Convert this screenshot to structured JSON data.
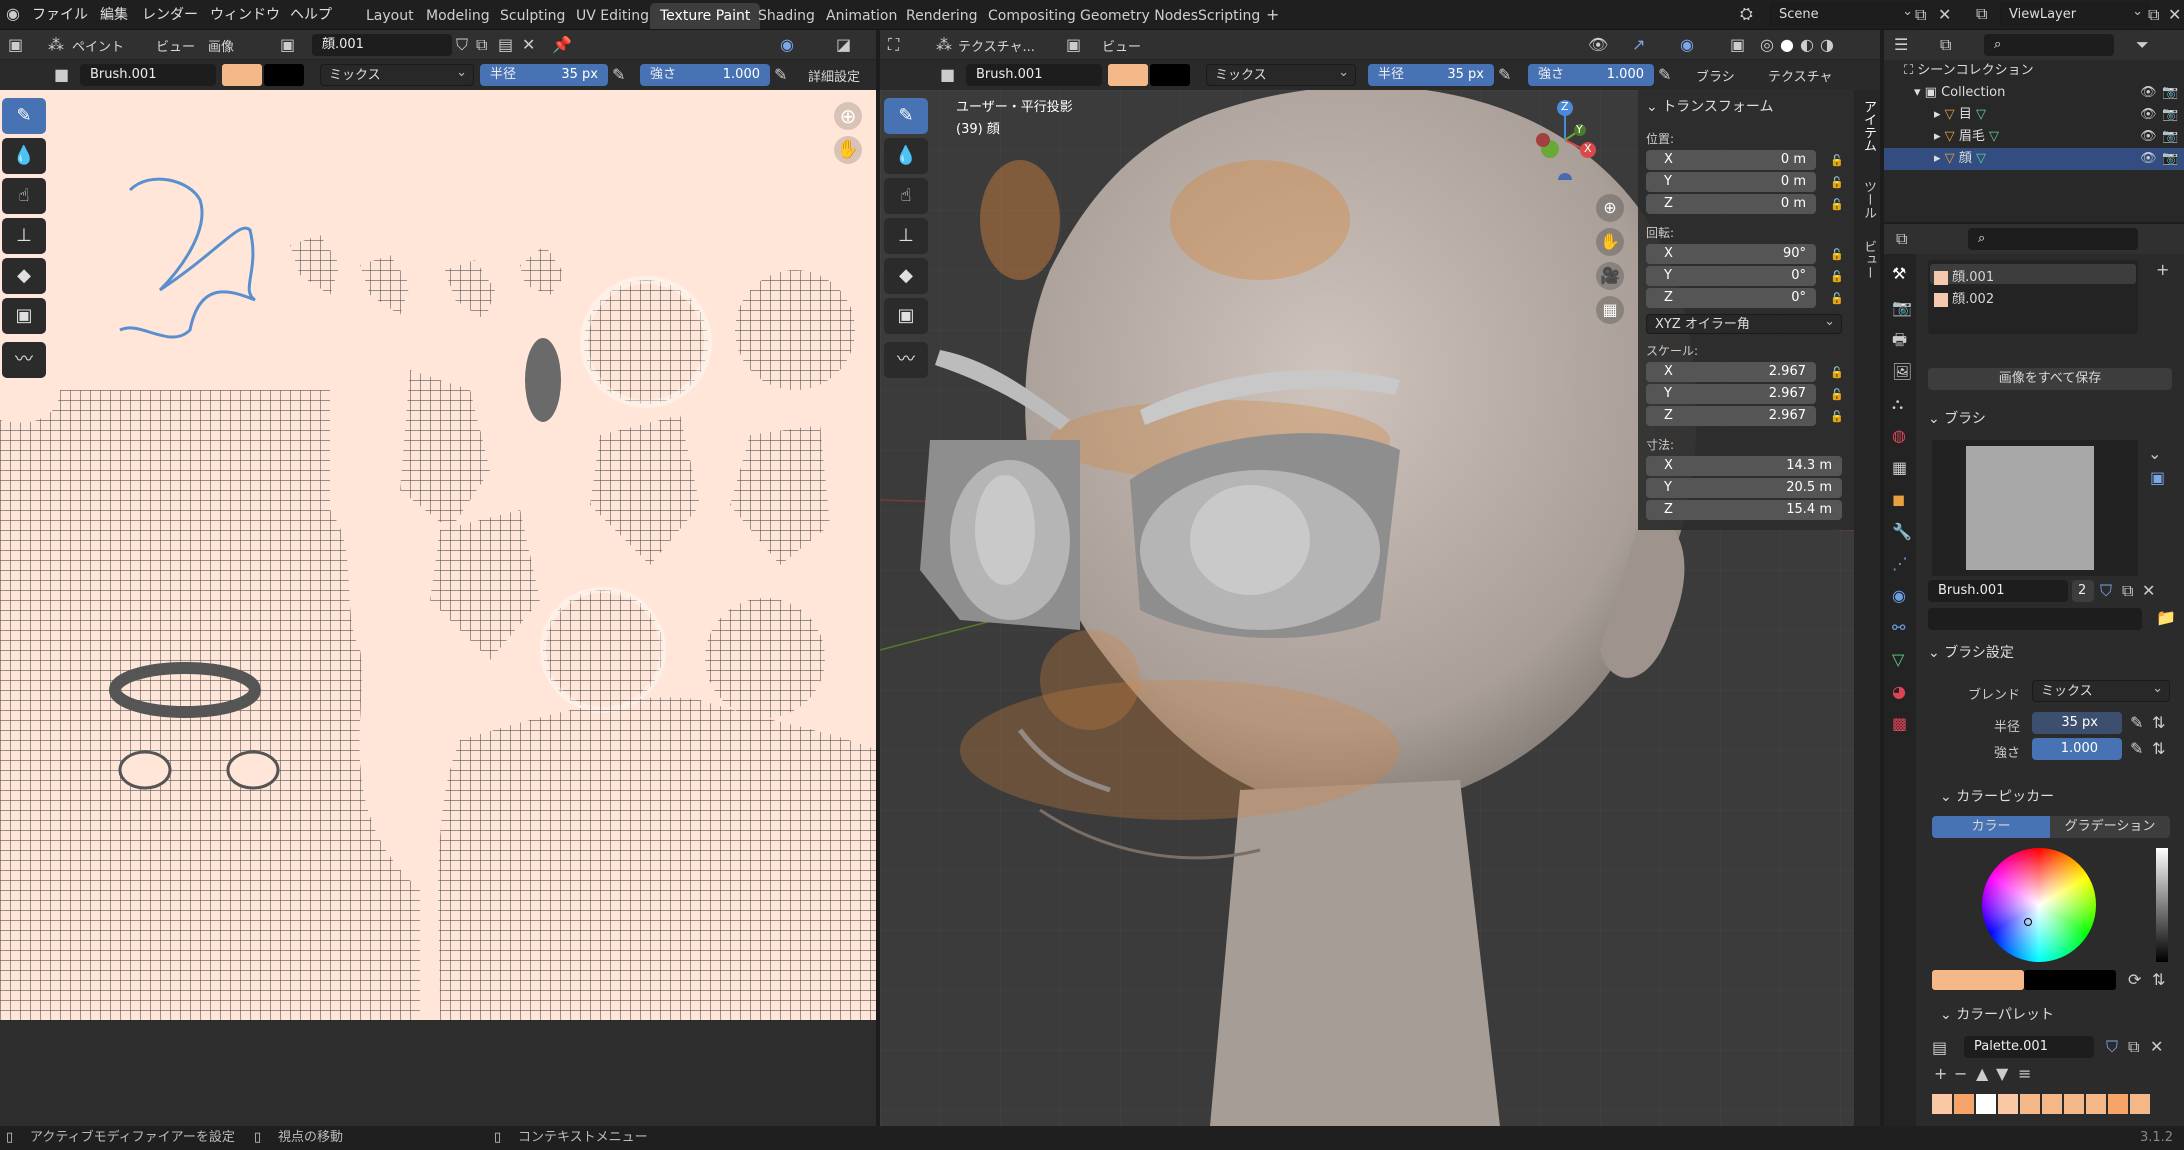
{
  "menu": {
    "items": [
      "ファイル",
      "編集",
      "レンダー",
      "ウィンドウ",
      "ヘルプ"
    ]
  },
  "workspaces": [
    "Layout",
    "Modeling",
    "Sculpting",
    "UV Editing",
    "Texture Paint",
    "Shading",
    "Animation",
    "Rendering",
    "Compositing",
    "Geometry Nodes",
    "Scripting"
  ],
  "active_workspace": "Texture Paint",
  "scene": {
    "name": "Scene",
    "viewlayer": "ViewLayer"
  },
  "image_editor": {
    "mode": "ペイント",
    "menus": [
      "ビュー",
      "画像"
    ],
    "image_name": "顔.001",
    "brush": "Brush.001",
    "color_primary": "#f5b889",
    "color_secondary": "#000000",
    "blend": "ミックス",
    "radius_label": "半径",
    "radius_value": "35 px",
    "strength_label": "強さ",
    "strength_value": "1.000",
    "detail_label": "詳細設定"
  },
  "viewport": {
    "mode": "テクスチャ...",
    "menus": [
      "ビュー"
    ],
    "brush": "Brush.001",
    "blend": "ミックス",
    "radius_label": "半径",
    "radius_value": "35 px",
    "strength_label": "強さ",
    "strength_value": "1.000",
    "extra_menus": [
      "ブラシ",
      "テクスチャ"
    ],
    "overlay_title": "ユーザー・平行投影",
    "overlay_object": "(39) 顔",
    "gizmo": {
      "x": "X",
      "y": "Y",
      "z": "Z"
    }
  },
  "npanel": {
    "section": "トランスフォーム",
    "location_label": "位置:",
    "location": [
      {
        "axis": "X",
        "value": "0 m"
      },
      {
        "axis": "Y",
        "value": "0 m"
      },
      {
        "axis": "Z",
        "value": "0 m"
      }
    ],
    "rotation_label": "回転:",
    "rotation": [
      {
        "axis": "X",
        "value": "90°"
      },
      {
        "axis": "Y",
        "value": "0°"
      },
      {
        "axis": "Z",
        "value": "0°"
      }
    ],
    "rotation_mode": "XYZ オイラー角",
    "scale_label": "スケール:",
    "scale": [
      {
        "axis": "X",
        "value": "2.967"
      },
      {
        "axis": "Y",
        "value": "2.967"
      },
      {
        "axis": "Z",
        "value": "2.967"
      }
    ],
    "dimensions_label": "寸法:",
    "dimensions": [
      {
        "axis": "X",
        "value": "14.3 m"
      },
      {
        "axis": "Y",
        "value": "20.5 m"
      },
      {
        "axis": "Z",
        "value": "15.4 m"
      }
    ],
    "tabs": [
      "アイテム",
      "ツール",
      "ビュー"
    ]
  },
  "outliner": {
    "root": "シーンコレクション",
    "collection": "Collection",
    "objects": [
      "目",
      "眉毛",
      "顔"
    ]
  },
  "properties": {
    "images": [
      "顔.001",
      "顔.002"
    ],
    "save_all": "画像をすべて保存",
    "brush_section": "ブラシ",
    "brush_name": "Brush.001",
    "brush_users": "2",
    "brush_settings": "ブラシ設定",
    "blend_label": "ブレンド",
    "blend_value": "ミックス",
    "radius_label": "半径",
    "radius_value": "35 px",
    "strength_label": "強さ",
    "strength_value": "1.000",
    "color_picker": "カラーピッカー",
    "color_tab": "カラー",
    "gradient_tab": "グラデーション",
    "palette_section": "カラーパレット",
    "palette_name": "Palette.001",
    "palette_colors": [
      "#f5b889",
      "#f5a46a",
      "#ffffff",
      "#f8c9a4",
      "#f5b889",
      "#f5b889",
      "#f5b889",
      "#f5b889",
      "#f5b889",
      "#f5b889",
      "#f5b889"
    ]
  },
  "status": {
    "left": "アクティブモディファイアーを設定",
    "middle": "視点の移動",
    "right": "コンテキストメニュー",
    "version": "3.1.2"
  }
}
